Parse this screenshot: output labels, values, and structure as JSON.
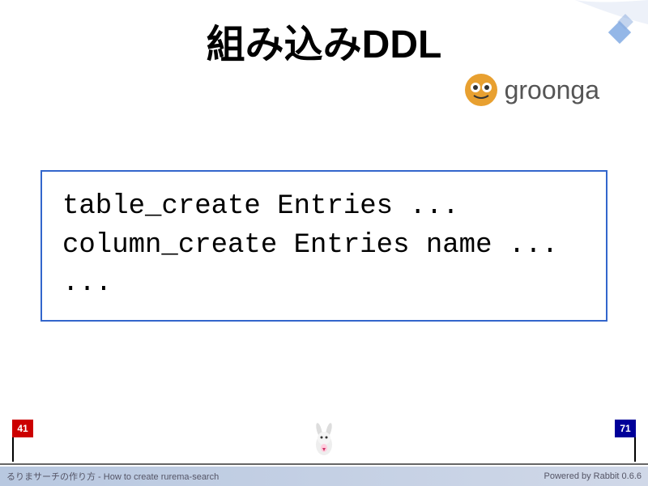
{
  "slide": {
    "title": "組み込みDDL",
    "logo_text": "groonga",
    "code_lines": [
      "table_create Entries ...",
      "column_create Entries name ...",
      "..."
    ]
  },
  "progress": {
    "current": "41",
    "total": "71"
  },
  "footer": {
    "left": "るりまサーチの作り方 - How to create rurema-search",
    "right": "Powered by Rabbit 0.6.6"
  },
  "colors": {
    "border": "#3366cc",
    "flag_left": "#cc0000",
    "flag_right": "#000099"
  }
}
